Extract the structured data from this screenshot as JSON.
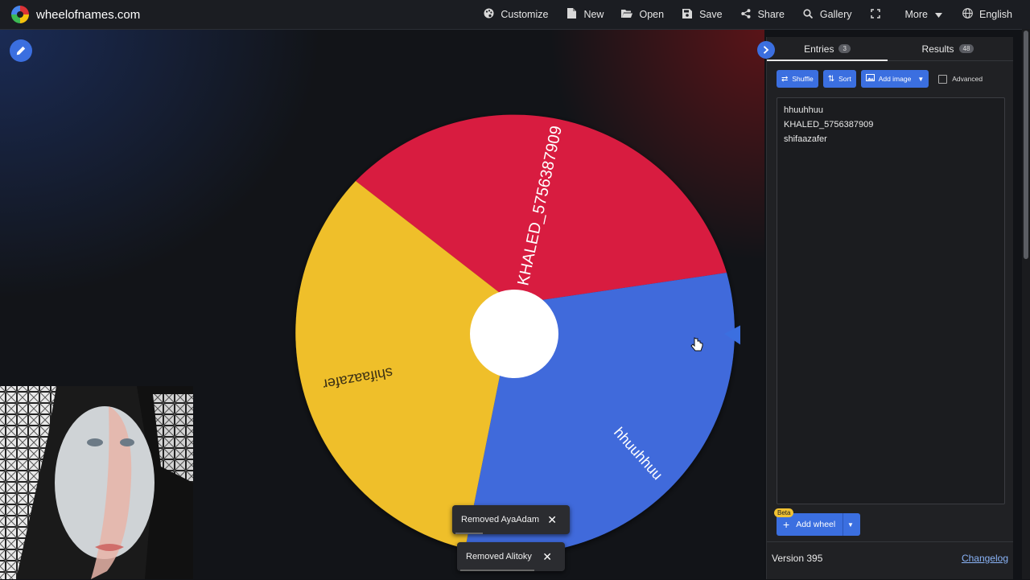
{
  "app": {
    "site_name": "wheelofnames.com"
  },
  "nav": {
    "customize": "Customize",
    "new": "New",
    "open": "Open",
    "save": "Save",
    "share": "Share",
    "gallery": "Gallery",
    "more": "More",
    "language": "English"
  },
  "wheel": {
    "segments": [
      {
        "label": "KHALED_5756387909",
        "color": "#d81e3f"
      },
      {
        "label": "hhuuhhuu",
        "color": "#3f6adb"
      },
      {
        "label": "shifaazafer",
        "color": "#efbf29"
      }
    ]
  },
  "toasts": [
    {
      "text": "Removed AyaAdam",
      "close": "✕"
    },
    {
      "text": "Removed Alitoky",
      "close": "✕"
    }
  ],
  "panel": {
    "tabs": [
      {
        "label": "Entries",
        "count": "3"
      },
      {
        "label": "Results",
        "count": "48"
      }
    ],
    "tools": {
      "shuffle": "Shuffle",
      "sort": "Sort",
      "add_image": "Add image",
      "advanced": "Advanced"
    },
    "entries": [
      "hhuuhhuu",
      "KHALED_5756387909",
      "shifaazafer"
    ],
    "add_wheel": "Add wheel",
    "beta": "Beta",
    "version": "Version 395",
    "changelog": "Changelog"
  },
  "colors": {
    "accent": "#3b6fe0",
    "panel_bg": "#202124"
  }
}
